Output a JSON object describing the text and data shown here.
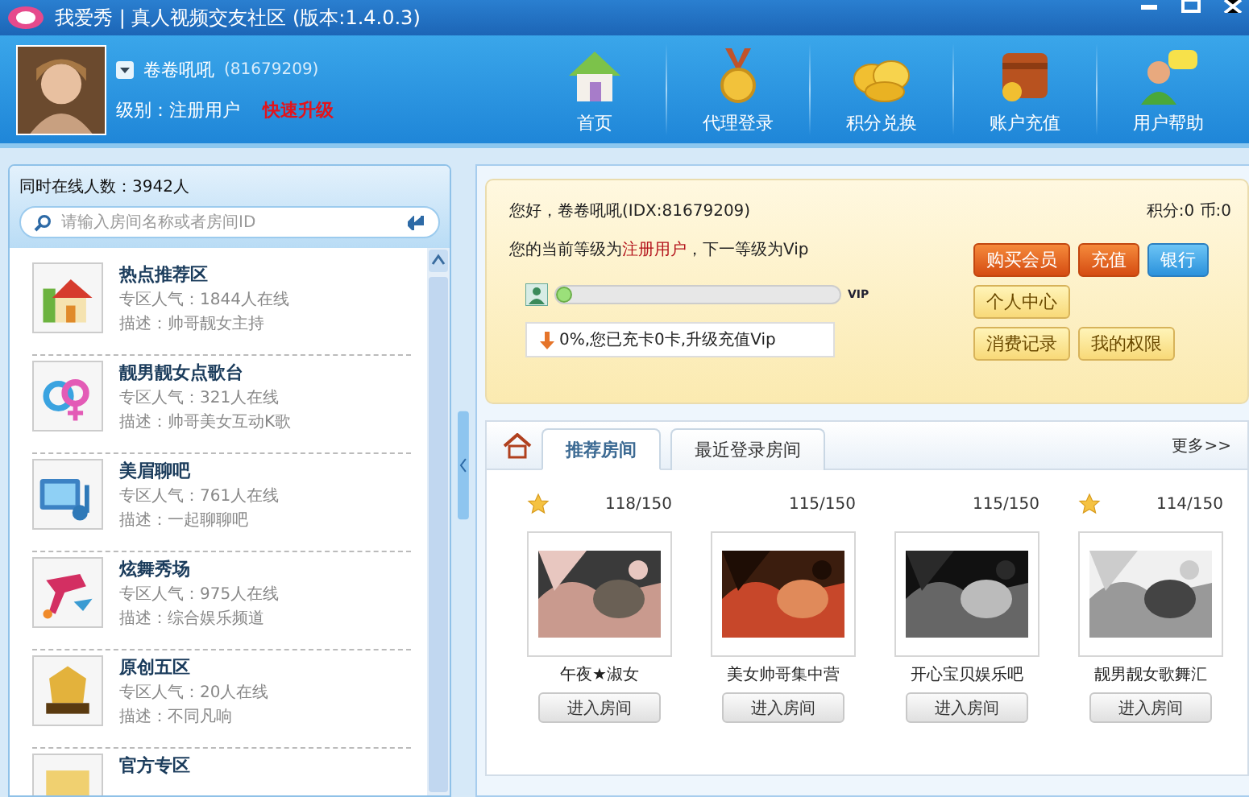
{
  "window": {
    "title": "我爱秀 | 真人视频交友社区 (版本:1.4.0.3)"
  },
  "user": {
    "name": "卷卷吼吼",
    "id": "(81679209)",
    "level_label": "级别：注册用户",
    "upgrade": "快速升级"
  },
  "nav": [
    {
      "label": "首页"
    },
    {
      "label": "代理登录"
    },
    {
      "label": "积分兑换"
    },
    {
      "label": "账户充值"
    },
    {
      "label": "用户帮助"
    }
  ],
  "sidebar": {
    "online": "同时在线人数：3942人",
    "search": {
      "placeholder": "请输入房间名称或者房间ID"
    },
    "zones": [
      {
        "title": "热点推荐区",
        "popularity": "专区人气：1844人在线",
        "description": "描述：帅哥靓女主持"
      },
      {
        "title": "靓男靓女点歌台",
        "popularity": "专区人气：321人在线",
        "description": "描述：帅哥美女互动K歌"
      },
      {
        "title": "美眉聊吧",
        "popularity": "专区人气：761人在线",
        "description": "描述：一起聊聊吧"
      },
      {
        "title": "炫舞秀场",
        "popularity": "专区人气：975人在线",
        "description": "描述：综合娱乐频道"
      },
      {
        "title": "原创五区",
        "popularity": "专区人气：20人在线",
        "description": "描述：不同凡响"
      },
      {
        "title": "官方专区"
      }
    ]
  },
  "welcome": {
    "greeting": "您好，卷卷吼吼(IDX:81679209)",
    "balance": "积分:0 币:0",
    "level_prefix": "您的当前等级为",
    "level_current": "注册用户",
    "level_suffix": "，下一等级为Vip",
    "progress": {
      "level": 0,
      "badge": "VIP",
      "note": "0%,您已充卡0卡,升级充值Vip"
    },
    "buttons": [
      {
        "label": "购买会员",
        "kind": "orange"
      },
      {
        "label": "充值",
        "kind": "orange"
      },
      {
        "label": "银行",
        "kind": "blue"
      },
      {
        "label": "个人中心",
        "kind": "plain"
      },
      {
        "label": "消费记录",
        "kind": "plain"
      },
      {
        "label": "我的权限",
        "kind": "plain"
      }
    ]
  },
  "rooms_panel": {
    "tabs": [
      {
        "label": "推荐房间",
        "selected": true
      },
      {
        "label": "最近登录房间",
        "selected": false
      }
    ],
    "more": "更多>>",
    "rooms": [
      {
        "count": "118/150",
        "starred": true,
        "name": "午夜★淑女",
        "button": "进入房间"
      },
      {
        "count": "115/150",
        "starred": false,
        "name": "美女帅哥集中营",
        "button": "进入房间"
      },
      {
        "count": "115/150",
        "starred": false,
        "name": "开心宝贝娱乐吧",
        "button": "进入房间"
      },
      {
        "count": "114/150",
        "starred": true,
        "name": "靓男靓女歌舞汇",
        "button": "进入房间"
      }
    ]
  }
}
